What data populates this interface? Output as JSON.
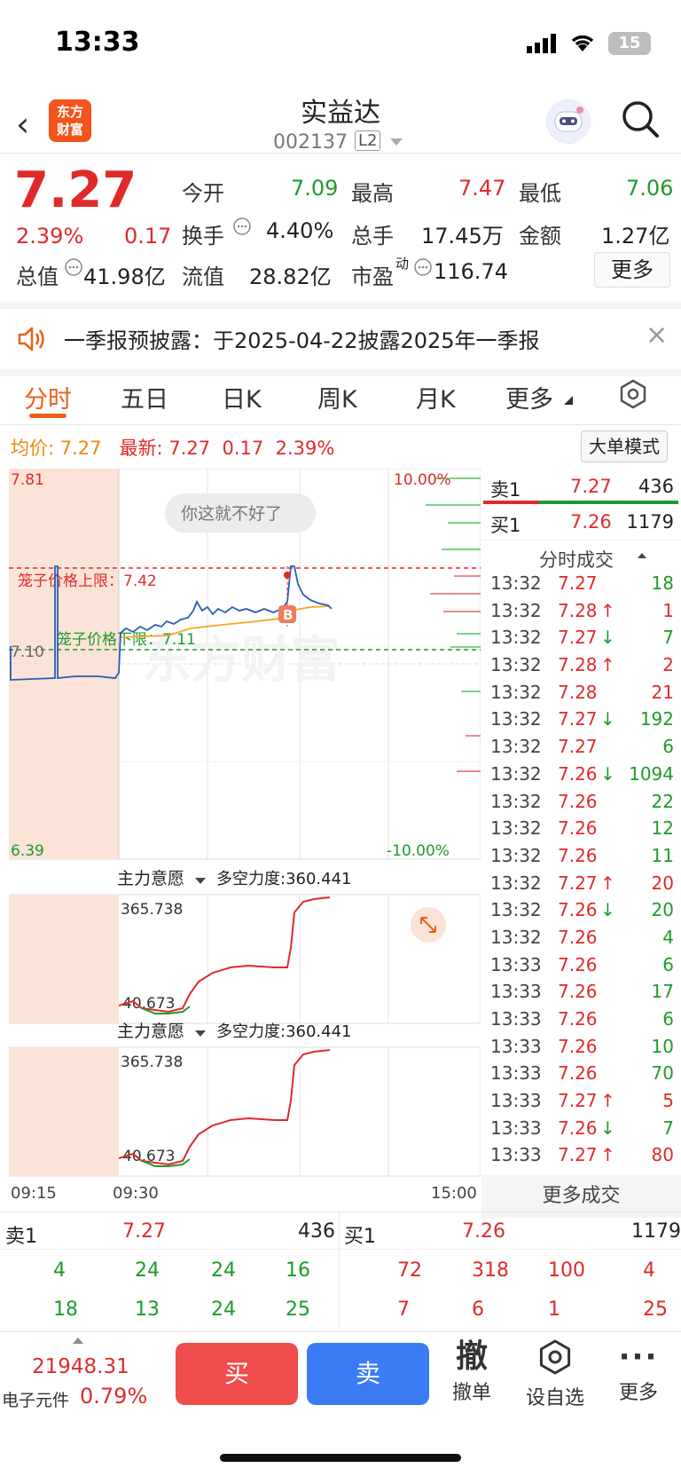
{
  "status": {
    "time": "13:33",
    "battery": "15"
  },
  "header": {
    "logo_line1": "东方",
    "logo_line2": "财富",
    "stock_name": "实益达",
    "stock_code": "002137",
    "level": "L2"
  },
  "quote": {
    "price": "7.27",
    "change_pct": "2.39%",
    "change": "0.17",
    "open_label": "今开",
    "open": "7.09",
    "high_label": "最高",
    "high": "7.47",
    "low_label": "最低",
    "low": "7.06",
    "turnover_label": "换手",
    "turnover": "4.40%",
    "volume_label": "总手",
    "volume": "17.45万",
    "amount_label": "金额",
    "amount": "1.27亿",
    "mcap_label": "总值",
    "mcap": "41.98亿",
    "float_label": "流值",
    "float": "28.82亿",
    "pe_label": "市盈",
    "pe_sup": "动",
    "pe": "116.74",
    "more": "更多"
  },
  "notice": {
    "text": "一季报预披露：于2025-04-22披露2025年一季报",
    "close": "×"
  },
  "tabs": [
    "分时",
    "五日",
    "日K",
    "周K",
    "月K",
    "更多"
  ],
  "info": {
    "avg_label": "均价:",
    "avg": "7.27",
    "last_label": "最新:",
    "last": "7.27",
    "chg": "0.17",
    "pct": "2.39%",
    "mode": "大单模式"
  },
  "chart": {
    "y_top": "7.81",
    "y_mid": "7.10",
    "y_bot": "6.39",
    "pct_top": "10.00%",
    "pct_bot": "-10.00%",
    "toast": "你这就不好了",
    "upper_label": "笼子价格上限：7.42",
    "lower_label": "笼子价格下限：7.11",
    "b_marker": "B",
    "watermark": "东方财富",
    "sub_indicator": "主力意愿",
    "sub_metric": "多空力度:360.441",
    "sub_max": "365.738",
    "sub_min": "40.673",
    "t_start": "09:15",
    "t_open": "09:30",
    "t_end": "15:00"
  },
  "orderbook": {
    "sell1_label": "卖1",
    "sell1_price": "7.27",
    "sell1_vol": "436",
    "buy1_label": "买1",
    "buy1_price": "7.26",
    "buy1_vol": "1179",
    "trades_title": "分时成交",
    "trades": [
      {
        "t": "13:32",
        "p": "7.27",
        "a": "",
        "v": "18",
        "pc": "red",
        "vc": "green"
      },
      {
        "t": "13:32",
        "p": "7.28",
        "a": "↑",
        "v": "1",
        "pc": "red",
        "vc": "red"
      },
      {
        "t": "13:32",
        "p": "7.27",
        "a": "↓",
        "v": "7",
        "pc": "red",
        "vc": "green"
      },
      {
        "t": "13:32",
        "p": "7.28",
        "a": "↑",
        "v": "2",
        "pc": "red",
        "vc": "red"
      },
      {
        "t": "13:32",
        "p": "7.28",
        "a": "",
        "v": "21",
        "pc": "red",
        "vc": "red"
      },
      {
        "t": "13:32",
        "p": "7.27",
        "a": "↓",
        "v": "192",
        "pc": "red",
        "vc": "green"
      },
      {
        "t": "13:32",
        "p": "7.27",
        "a": "",
        "v": "6",
        "pc": "red",
        "vc": "green"
      },
      {
        "t": "13:32",
        "p": "7.26",
        "a": "↓",
        "v": "1094",
        "pc": "red",
        "vc": "green"
      },
      {
        "t": "13:32",
        "p": "7.26",
        "a": "",
        "v": "22",
        "pc": "red",
        "vc": "green"
      },
      {
        "t": "13:32",
        "p": "7.26",
        "a": "",
        "v": "12",
        "pc": "red",
        "vc": "green"
      },
      {
        "t": "13:32",
        "p": "7.26",
        "a": "",
        "v": "11",
        "pc": "red",
        "vc": "green"
      },
      {
        "t": "13:32",
        "p": "7.27",
        "a": "↑",
        "v": "20",
        "pc": "red",
        "vc": "red"
      },
      {
        "t": "13:32",
        "p": "7.26",
        "a": "↓",
        "v": "20",
        "pc": "red",
        "vc": "green"
      },
      {
        "t": "13:32",
        "p": "7.26",
        "a": "",
        "v": "4",
        "pc": "red",
        "vc": "green"
      },
      {
        "t": "13:33",
        "p": "7.26",
        "a": "",
        "v": "6",
        "pc": "red",
        "vc": "green"
      },
      {
        "t": "13:33",
        "p": "7.26",
        "a": "",
        "v": "17",
        "pc": "red",
        "vc": "green"
      },
      {
        "t": "13:33",
        "p": "7.26",
        "a": "",
        "v": "6",
        "pc": "red",
        "vc": "green"
      },
      {
        "t": "13:33",
        "p": "7.26",
        "a": "",
        "v": "10",
        "pc": "red",
        "vc": "green"
      },
      {
        "t": "13:33",
        "p": "7.26",
        "a": "",
        "v": "70",
        "pc": "red",
        "vc": "green"
      },
      {
        "t": "13:33",
        "p": "7.27",
        "a": "↑",
        "v": "5",
        "pc": "red",
        "vc": "red"
      },
      {
        "t": "13:33",
        "p": "7.26",
        "a": "↓",
        "v": "7",
        "pc": "red",
        "vc": "green"
      },
      {
        "t": "13:33",
        "p": "7.27",
        "a": "↑",
        "v": "80",
        "pc": "red",
        "vc": "red"
      }
    ],
    "more_trades": "更多成交"
  },
  "bottombook": {
    "sell_label": "卖1",
    "sell_price": "7.27",
    "sell_vol": "436",
    "buy_label": "买1",
    "buy_price": "7.26",
    "buy_vol": "1179",
    "left_row1": [
      "4",
      "24",
      "24",
      "16"
    ],
    "left_row2": [
      "18",
      "13",
      "24",
      "25"
    ],
    "right_row1": [
      "72",
      "318",
      "100",
      "4"
    ],
    "right_row2": [
      "7",
      "6",
      "1",
      "25"
    ]
  },
  "bottombar": {
    "index_value": "21948.31",
    "index_name": "电子元件",
    "index_pct": "0.79%",
    "buy": "买",
    "sell": "卖",
    "cancel_glyph": "撤",
    "cancel": "撤单",
    "watch": "设自选",
    "more": "更多"
  }
}
